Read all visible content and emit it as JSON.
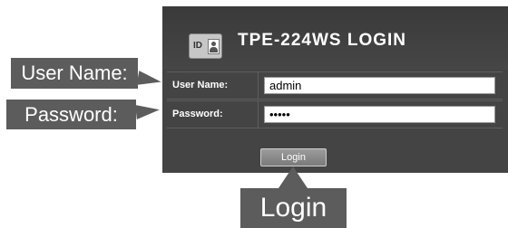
{
  "header": {
    "title": "TPE-224WS LOGIN",
    "badge_text": "ID"
  },
  "form": {
    "username": {
      "label": "User Name:",
      "value": "admin"
    },
    "password": {
      "label": "Password:",
      "value": "•••••"
    },
    "login_button": "Login"
  },
  "callouts": {
    "username": "User Name:",
    "password": "Password:",
    "login": "Login"
  },
  "colors": {
    "panel_background": "#444444",
    "callout_background": "#5c5c5c"
  }
}
